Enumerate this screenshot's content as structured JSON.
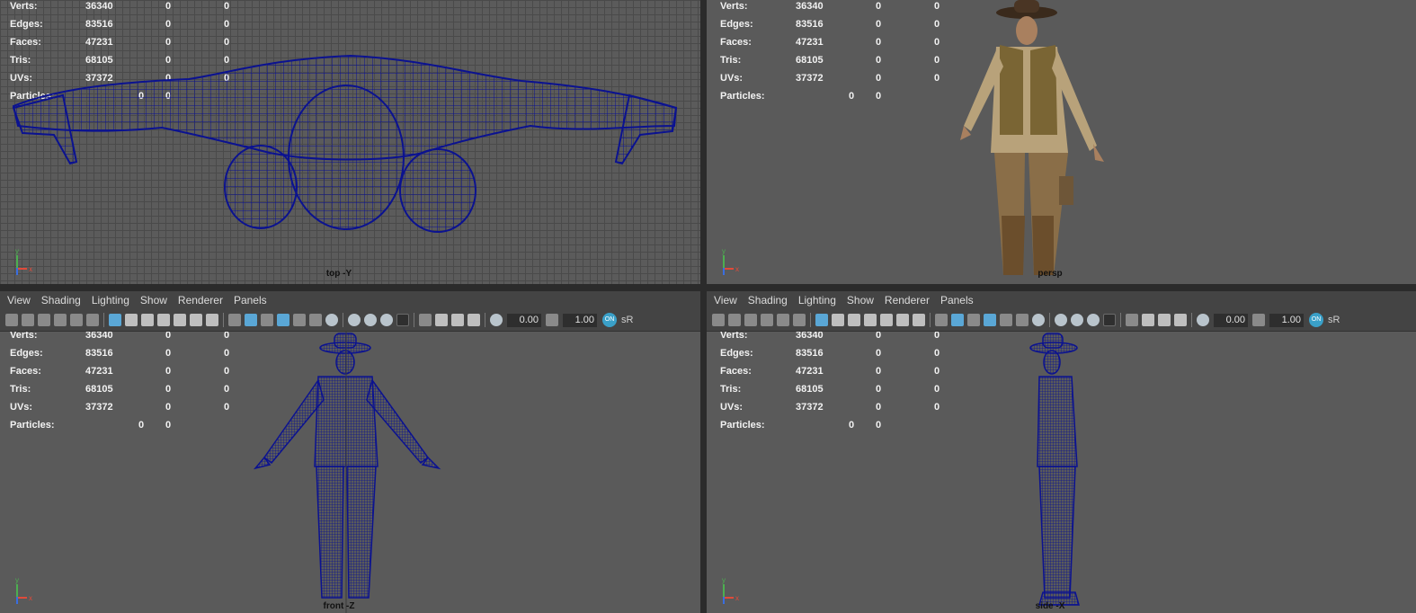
{
  "stats_labels": {
    "verts": "Verts:",
    "edges": "Edges:",
    "faces": "Faces:",
    "tris": "Tris:",
    "uvs": "UVs:",
    "particles": "Particles:"
  },
  "stats_values": {
    "verts": [
      "36340",
      "0",
      "0"
    ],
    "edges": [
      "83516",
      "0",
      "0"
    ],
    "faces": [
      "47231",
      "0",
      "0"
    ],
    "tris": [
      "68105",
      "0",
      "0"
    ],
    "uvs": [
      "37372",
      "0",
      "0"
    ],
    "particles": [
      "0",
      "0"
    ]
  },
  "menu": {
    "view": "View",
    "shading": "Shading",
    "lighting": "Lighting",
    "show": "Show",
    "renderer": "Renderer",
    "panels": "Panels"
  },
  "toolbar": {
    "exposure": "0.00",
    "gamma": "1.00",
    "on_label": "ON",
    "color_space": "sR"
  },
  "axis": {
    "y": "y",
    "x": "x"
  },
  "cameras": {
    "top": "top -Y",
    "persp": "persp",
    "front": "front -Z",
    "side": "side -X"
  },
  "colors": {
    "wireframe": "#0b1290",
    "viewport_bg": "#5a5a5a",
    "panel_bar": "#444444"
  }
}
